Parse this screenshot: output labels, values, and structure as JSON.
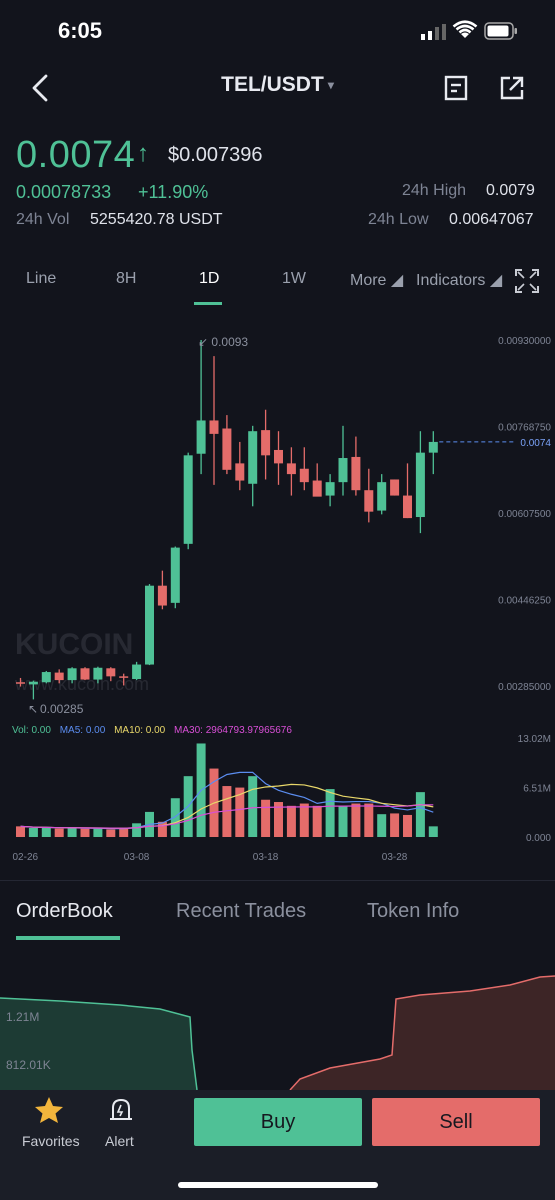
{
  "status": {
    "time": "6:05"
  },
  "header": {
    "pair": "TEL/USDT",
    "caret": "▾"
  },
  "ticker": {
    "price": "0.0074",
    "arrow": "↑",
    "usd_price": "$0.007396",
    "btc_price": "0.00078733",
    "change_pct": "+11.90%",
    "vol_label": "24h Vol",
    "vol_value": "5255420.78 USDT",
    "high_label": "24h High",
    "high_value": "0.0079",
    "low_label": "24h Low",
    "low_value": "0.00647067"
  },
  "interval_tabs": [
    {
      "label": "Line"
    },
    {
      "label": "8H"
    },
    {
      "label": "1D",
      "active": true
    },
    {
      "label": "1W"
    },
    {
      "label": "More ◢"
    },
    {
      "label": "Indicators ◢"
    }
  ],
  "chart": {
    "watermark": "KUCOIN",
    "watermark_sub": "www.kucoin.com",
    "max_label": "0.0093",
    "min_label": "0.00285",
    "y_ticks": [
      "0.00930000",
      "0.00768750",
      "0.00607500",
      "0.00446250",
      "0.00285000"
    ],
    "current_label": "0.0074",
    "vol_y_ticks": [
      "13.02M",
      "6.51M",
      "0.000"
    ],
    "x_ticks": [
      "02-26",
      "03-08",
      "03-18",
      "03-28"
    ],
    "vol_legend": {
      "vol": "Vol: 0.00",
      "ma5": "MA5: 0.00",
      "ma10": "MA10: 0.00",
      "ma30": "MA30: 2964793.97965676"
    },
    "colors": {
      "up": "#4fc196",
      "down": "#e46c6a",
      "ma5": "#5b8df0",
      "ma10": "#e9d86a",
      "ma30": "#d84fd6"
    }
  },
  "chart_data": {
    "type": "candlestick",
    "title": "",
    "xlabel": "",
    "ylabel": "",
    "ylim": [
      0.00285,
      0.0093
    ],
    "x_ticks": [
      "02-26",
      "03-08",
      "03-18",
      "03-28"
    ],
    "candles": [
      {
        "o": 0.00292,
        "h": 0.003,
        "l": 0.00284,
        "c": 0.0029
      },
      {
        "o": 0.00288,
        "h": 0.00295,
        "l": 0.0026,
        "c": 0.00293
      },
      {
        "o": 0.00292,
        "h": 0.00313,
        "l": 0.0029,
        "c": 0.00311
      },
      {
        "o": 0.0031,
        "h": 0.00316,
        "l": 0.0029,
        "c": 0.00296
      },
      {
        "o": 0.00296,
        "h": 0.0032,
        "l": 0.0029,
        "c": 0.00318
      },
      {
        "o": 0.00318,
        "h": 0.0032,
        "l": 0.00296,
        "c": 0.00297
      },
      {
        "o": 0.00297,
        "h": 0.00321,
        "l": 0.0029,
        "c": 0.00319
      },
      {
        "o": 0.00318,
        "h": 0.0032,
        "l": 0.00294,
        "c": 0.00303
      },
      {
        "o": 0.00303,
        "h": 0.00308,
        "l": 0.00286,
        "c": 0.00302
      },
      {
        "o": 0.00298,
        "h": 0.0033,
        "l": 0.00296,
        "c": 0.00325
      },
      {
        "o": 0.00325,
        "h": 0.00475,
        "l": 0.00324,
        "c": 0.00472
      },
      {
        "o": 0.00472,
        "h": 0.005,
        "l": 0.00428,
        "c": 0.00435
      },
      {
        "o": 0.0044,
        "h": 0.00545,
        "l": 0.0043,
        "c": 0.00543
      },
      {
        "o": 0.0055,
        "h": 0.0072,
        "l": 0.0054,
        "c": 0.00715
      },
      {
        "o": 0.00718,
        "h": 0.0093,
        "l": 0.0068,
        "c": 0.0078
      },
      {
        "o": 0.0078,
        "h": 0.009,
        "l": 0.0066,
        "c": 0.00755
      },
      {
        "o": 0.00765,
        "h": 0.0079,
        "l": 0.0068,
        "c": 0.00688
      },
      {
        "o": 0.007,
        "h": 0.0074,
        "l": 0.0065,
        "c": 0.00668
      },
      {
        "o": 0.00662,
        "h": 0.0077,
        "l": 0.0062,
        "c": 0.0076
      },
      {
        "o": 0.00762,
        "h": 0.008,
        "l": 0.0067,
        "c": 0.00715
      },
      {
        "o": 0.00725,
        "h": 0.0076,
        "l": 0.0066,
        "c": 0.007
      },
      {
        "o": 0.007,
        "h": 0.0073,
        "l": 0.0064,
        "c": 0.0068
      },
      {
        "o": 0.0069,
        "h": 0.0073,
        "l": 0.0065,
        "c": 0.00665
      },
      {
        "o": 0.00668,
        "h": 0.007,
        "l": 0.0064,
        "c": 0.00638
      },
      {
        "o": 0.0064,
        "h": 0.0068,
        "l": 0.0062,
        "c": 0.00665
      },
      {
        "o": 0.00665,
        "h": 0.0077,
        "l": 0.0064,
        "c": 0.0071
      },
      {
        "o": 0.00712,
        "h": 0.0075,
        "l": 0.0064,
        "c": 0.0065
      },
      {
        "o": 0.0065,
        "h": 0.0069,
        "l": 0.0059,
        "c": 0.0061
      },
      {
        "o": 0.00612,
        "h": 0.0068,
        "l": 0.00605,
        "c": 0.00665
      },
      {
        "o": 0.0067,
        "h": 0.0067,
        "l": 0.0064,
        "c": 0.0064
      },
      {
        "o": 0.0064,
        "h": 0.007,
        "l": 0.00598,
        "c": 0.00598
      },
      {
        "o": 0.006,
        "h": 0.0076,
        "l": 0.0057,
        "c": 0.0072
      },
      {
        "o": 0.0072,
        "h": 0.0076,
        "l": 0.0068,
        "c": 0.0074
      }
    ],
    "volumes": [
      1.4,
      1.2,
      1.2,
      1.1,
      1.2,
      1.1,
      1.1,
      1.0,
      1.1,
      1.8,
      3.3,
      2.0,
      5.1,
      8.0,
      12.3,
      9.0,
      6.7,
      6.5,
      8.0,
      4.9,
      4.6,
      4.1,
      4.4,
      4.1,
      6.3,
      4.1,
      4.4,
      4.4,
      3.0,
      3.1,
      2.9,
      5.9,
      1.4
    ],
    "volume_unit": "M",
    "volume_ylim": [
      0,
      13.02
    ]
  },
  "orderbook_tabs": [
    {
      "label": "OrderBook",
      "active": true
    },
    {
      "label": "Recent Trades"
    },
    {
      "label": "Token Info"
    }
  ],
  "depth": {
    "labels": [
      "1.21M",
      "812.01K"
    ]
  },
  "bottom": {
    "favorites": "Favorites",
    "alert": "Alert",
    "buy": "Buy",
    "sell": "Sell"
  }
}
